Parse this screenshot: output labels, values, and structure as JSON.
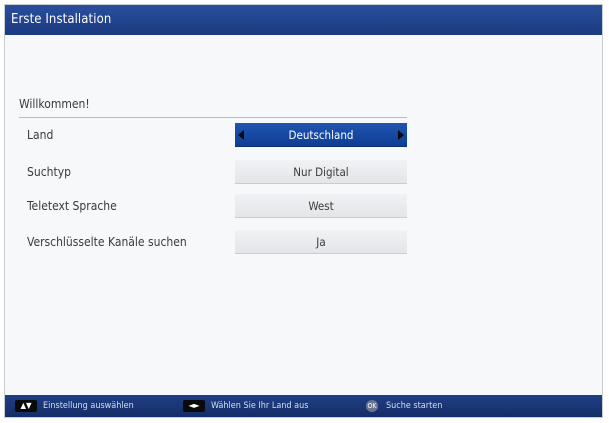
{
  "window": {
    "title": "Erste Installation"
  },
  "main": {
    "welcome": "Willkommen!",
    "settings": [
      {
        "label": "Land",
        "value": "Deutschland",
        "selected": true
      },
      {
        "label": "Suchtyp",
        "value": "Nur Digital",
        "selected": false
      },
      {
        "label": "Teletext Sprache",
        "value": "West",
        "selected": false
      },
      {
        "label": "Verschlüsselte Kanäle suchen",
        "value": "Ja",
        "selected": false
      }
    ]
  },
  "footer": {
    "hints": [
      {
        "icon": "up-down-icon",
        "key": "▲▼",
        "text": "Einstellung auswählen"
      },
      {
        "icon": "left-right-icon",
        "key": "◄►",
        "text": "Wählen Sie Ihr Land aus"
      },
      {
        "icon": "ok-icon",
        "key": "OK",
        "text": "Suche starten"
      }
    ]
  },
  "colors": {
    "titlebar": "#1b3a80",
    "selected": "#1f55b2",
    "footer": "#142d66"
  }
}
